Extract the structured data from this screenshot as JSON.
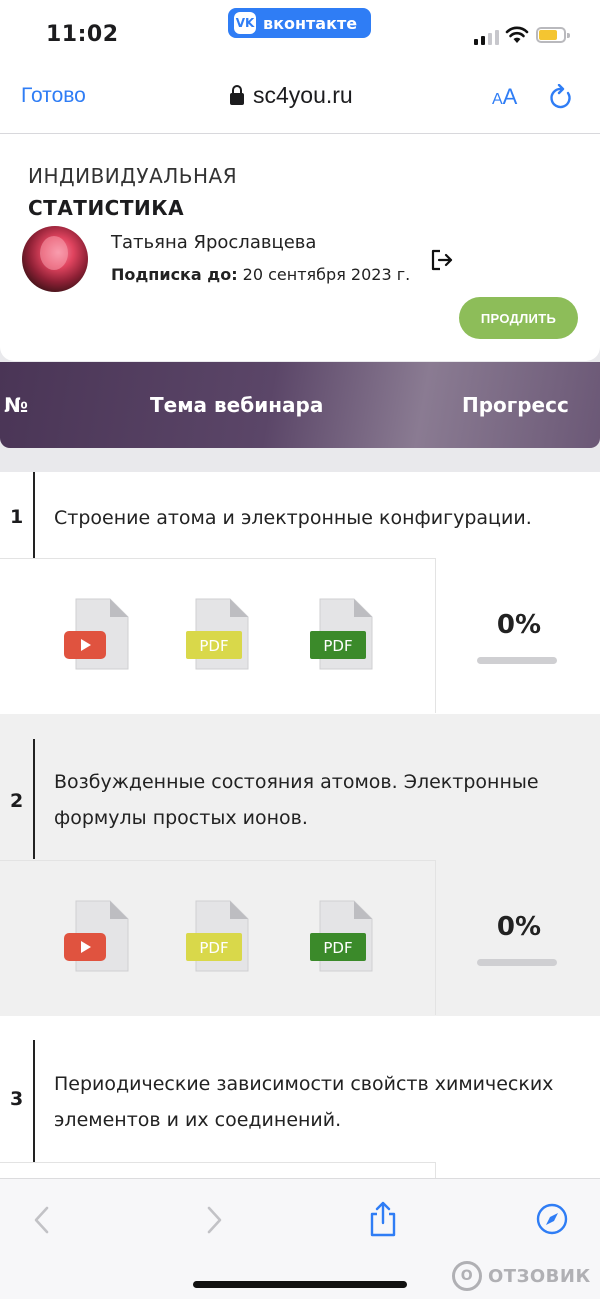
{
  "status_bar": {
    "time": "11:02",
    "app_badge": "вконтакте",
    "app_badge_logo": "vk",
    "signal_bars": 2,
    "signal_max": 4,
    "battery_color": "#f4c531"
  },
  "browser": {
    "done_label": "Готово",
    "url": "sc4you.ru",
    "text_size_small": "A",
    "text_size_large": "A"
  },
  "header": {
    "title_line1": "ИНДИВИДУАЛЬНАЯ",
    "title_line2": "СТАТИСТИКА",
    "user_name": "Татьяна Ярославцева",
    "subscription_label": "Подписка до:",
    "subscription_date": " 20 сентября 2023 г.",
    "renew_label": "ПРОДЛИТЬ"
  },
  "table": {
    "col_number": "№",
    "col_topic": "Тема вебинара",
    "col_progress": "Прогресс",
    "rows": [
      {
        "number": "1",
        "topic": "Строение атома и электронные конфигурации.",
        "progress_label": "0%",
        "progress": 0,
        "files": [
          {
            "icon": "video-file-icon"
          },
          {
            "icon": "pdf-file-icon-yellow",
            "label": "PDF"
          },
          {
            "icon": "pdf-file-icon-green",
            "label": "PDF"
          }
        ]
      },
      {
        "number": "2",
        "topic": "Возбужденные состояния атомов. Электронные формулы простых ионов.",
        "progress_label": "0%",
        "progress": 0,
        "files": [
          {
            "icon": "video-file-icon"
          },
          {
            "icon": "pdf-file-icon-yellow",
            "label": "PDF"
          },
          {
            "icon": "pdf-file-icon-green",
            "label": "PDF"
          }
        ]
      },
      {
        "number": "3",
        "topic": "Периодические зависимости свойств химических элементов и их соединений."
      }
    ]
  },
  "colors": {
    "accent": "#2f7df5",
    "renew_button": "#8dbd59",
    "pdf_yellow": "#d9d84a",
    "pdf_green": "#3b8a2a",
    "video_red": "#e0533f",
    "header_purple": "#4a3556"
  },
  "watermark": "ОТЗОВИК"
}
